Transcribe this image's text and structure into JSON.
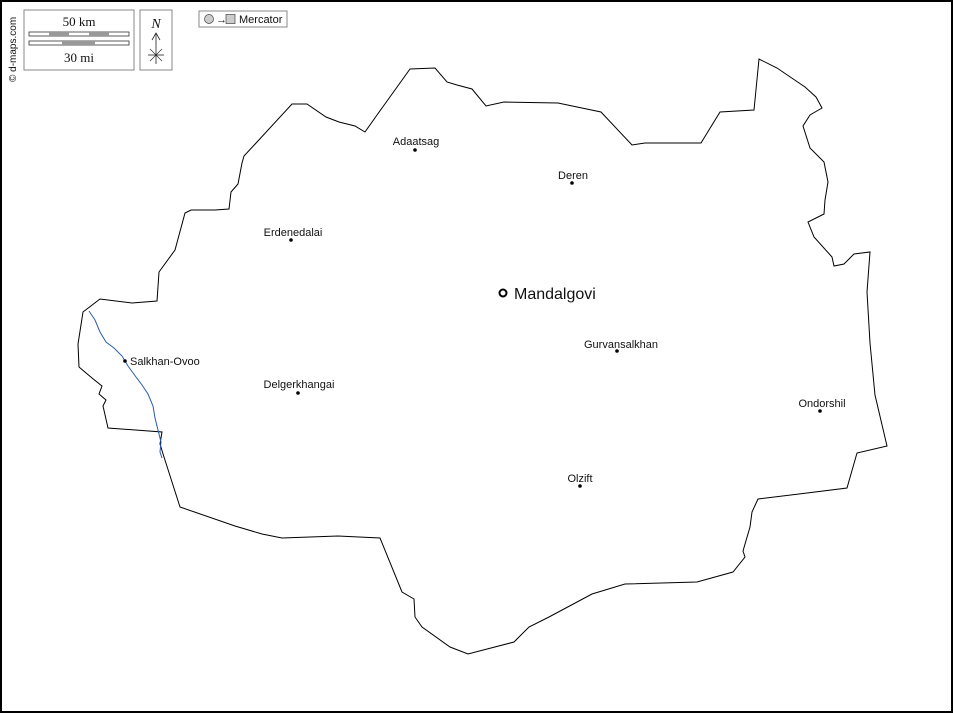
{
  "map": {
    "credit": "© d-maps.com",
    "projection_label": "Mercator",
    "north_label": "N",
    "scale": {
      "km_label": "50 km",
      "mi_label": "30 mi"
    },
    "capital": {
      "name": "Mandalgovi"
    },
    "places": [
      {
        "id": "adaatsag",
        "name": "Adaatsag"
      },
      {
        "id": "deren",
        "name": "Deren"
      },
      {
        "id": "erdenedalai",
        "name": "Erdenedalai"
      },
      {
        "id": "salkhan-ovoo",
        "name": "Salkhan-Ovoo"
      },
      {
        "id": "delgerkhangai",
        "name": "Delgerkhangai"
      },
      {
        "id": "gurvansalkhan",
        "name": "Gurvansalkhan"
      },
      {
        "id": "ondorshil",
        "name": "Ondorshil"
      },
      {
        "id": "olzift",
        "name": "Olzift"
      }
    ],
    "colors": {
      "border": "#000000",
      "river": "#2a5caa",
      "background": "#ffffff"
    }
  }
}
